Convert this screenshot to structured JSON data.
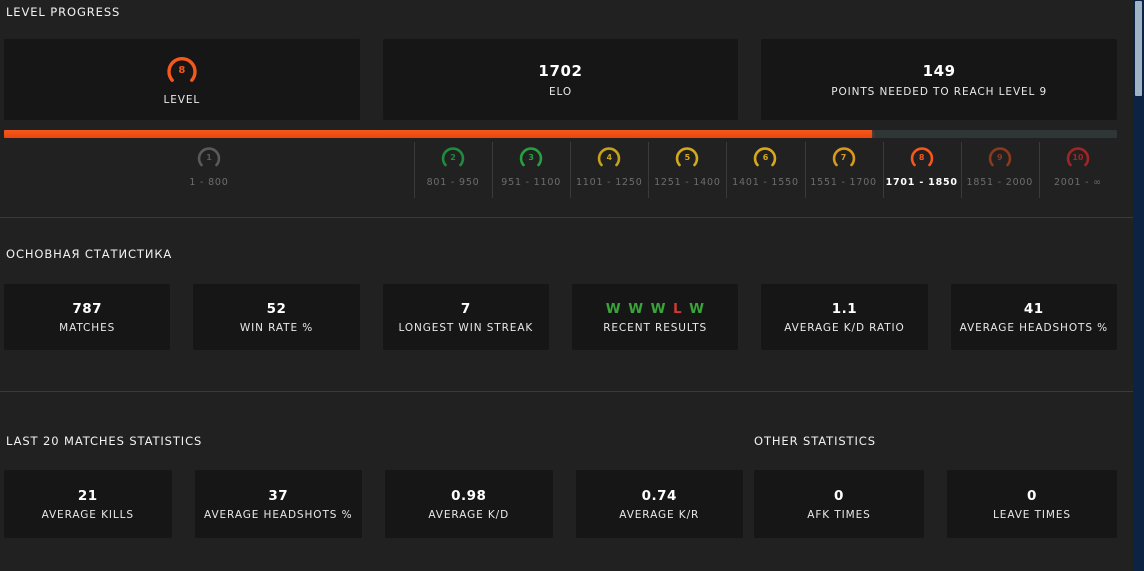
{
  "colors": {
    "background": "#212121",
    "card": "#161616",
    "accent_orange": "#f4581d",
    "track": "#2e3636",
    "win_green": "#3aa33a",
    "loss_red": "#cc3a35",
    "divider": "#3a3a3a",
    "scrollbar_track": "#0d2344",
    "scrollbar_thumb": "#9fb4c4"
  },
  "level_progress": {
    "title": "LEVEL PROGRESS",
    "cards": [
      {
        "type": "level_badge",
        "level": "8",
        "label": "LEVEL",
        "badge_color": "#f4581d"
      },
      {
        "type": "value",
        "value": "1702",
        "label": "ELO"
      },
      {
        "type": "value",
        "value": "149",
        "label": "POINTS NEEDED TO REACH LEVEL 9"
      }
    ],
    "progress_percent": 78,
    "current_level": 8,
    "levels": [
      {
        "level": "1",
        "range": "1 - 800",
        "color": "#5a5a5a",
        "current": false
      },
      {
        "level": "2",
        "range": "801 - 950",
        "color": "#1f8b3c",
        "current": false
      },
      {
        "level": "3",
        "range": "951 - 1100",
        "color": "#27a03f",
        "current": false
      },
      {
        "level": "4",
        "range": "1101 - 1250",
        "color": "#c6a31b",
        "current": false
      },
      {
        "level": "5",
        "range": "1251 - 1400",
        "color": "#d2aa1c",
        "current": false
      },
      {
        "level": "6",
        "range": "1401 - 1550",
        "color": "#d8a81c",
        "current": false
      },
      {
        "level": "7",
        "range": "1551 - 1700",
        "color": "#d99a1c",
        "current": false
      },
      {
        "level": "8",
        "range": "1701 - 1850",
        "color": "#f4581d",
        "current": true
      },
      {
        "level": "9",
        "range": "1851 - 2000",
        "color": "#8a3a1c",
        "current": false
      },
      {
        "level": "10",
        "range": "2001 - ∞",
        "color": "#a12526",
        "current": false
      }
    ]
  },
  "main_stats": {
    "title": "ОСНОВНАЯ СТАТИСТИКА",
    "cards": [
      {
        "value": "787",
        "label": "MATCHES"
      },
      {
        "value": "52",
        "label": "WIN RATE %"
      },
      {
        "value": "7",
        "label": "LONGEST WIN STREAK"
      },
      {
        "value": "",
        "label": "RECENT RESULTS",
        "results": [
          "W",
          "W",
          "W",
          "L",
          "W"
        ]
      },
      {
        "value": "1.1",
        "label": "AVERAGE K/D RATIO"
      },
      {
        "value": "41",
        "label": "AVERAGE HEADSHOTS %"
      }
    ]
  },
  "last_20_matches": {
    "title": "LAST 20 MATCHES STATISTICS",
    "cards": [
      {
        "value": "21",
        "label": "AVERAGE KILLS"
      },
      {
        "value": "37",
        "label": "AVERAGE HEADSHOTS %"
      },
      {
        "value": "0.98",
        "label": "AVERAGE K/D"
      },
      {
        "value": "0.74",
        "label": "AVERAGE K/R"
      }
    ]
  },
  "other_statistics": {
    "title": "OTHER STATISTICS",
    "cards": [
      {
        "value": "0",
        "label": "AFK TIMES"
      },
      {
        "value": "0",
        "label": "LEAVE TIMES"
      }
    ]
  }
}
